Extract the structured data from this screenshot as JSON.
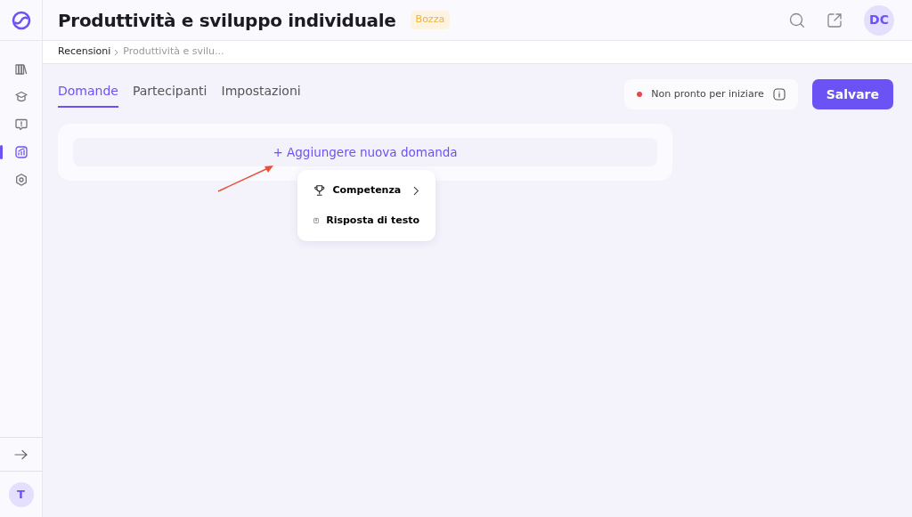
{
  "sidebar": {
    "items": [
      {
        "selected": false
      },
      {
        "selected": false
      },
      {
        "selected": false
      },
      {
        "selected": true
      },
      {
        "selected": false
      }
    ],
    "avatar": "T"
  },
  "header": {
    "title": "Produttività e sviluppo individuale",
    "badge": "Bozza",
    "avatar": "DC"
  },
  "breadcrumb": [
    {
      "label": "Recensioni",
      "current": false
    },
    {
      "label": "Produttività e svilu...",
      "current": true
    }
  ],
  "tabs": [
    {
      "label": "Domande",
      "selected": true
    },
    {
      "label": "Partecipanti",
      "selected": false
    },
    {
      "label": "Impostazioni",
      "selected": false
    }
  ],
  "status": {
    "label": "Non pronto per iniziare",
    "color": "#e5484d"
  },
  "save_button": "Salvare",
  "add_button": {
    "icon": "+",
    "label": "Aggiungere nuova domanda"
  },
  "menu": [
    {
      "kind": "submenu",
      "label": "Competenza"
    },
    {
      "kind": "item",
      "label": "Risposta di testo"
    }
  ]
}
